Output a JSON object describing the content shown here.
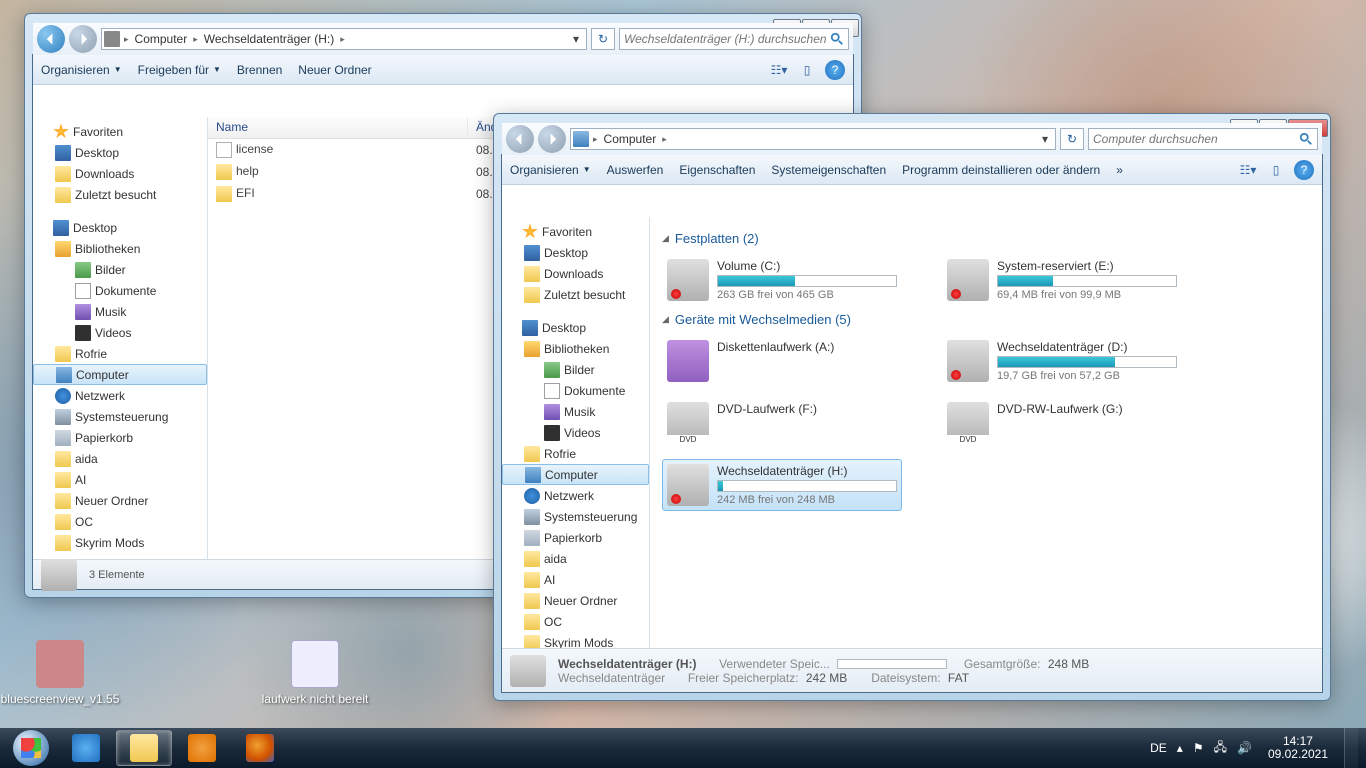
{
  "desktop_icons": [
    {
      "label": "bluescreenview_v1.55"
    },
    {
      "label": "laufwerk nicht bereit"
    }
  ],
  "win1": {
    "nav": {
      "crumb1": "Computer",
      "crumb2": "Wechseldatenträger (H:)"
    },
    "search_ph": "Wechseldatenträger (H:) durchsuchen",
    "toolbar": {
      "org": "Organisieren",
      "share": "Freigeben für",
      "burn": "Brennen",
      "newfolder": "Neuer Ordner"
    },
    "cols": {
      "name": "Name",
      "date": "Änd"
    },
    "files": [
      {
        "name": "license",
        "date": "08.0",
        "type": "file"
      },
      {
        "name": "help",
        "date": "08.0",
        "type": "folder"
      },
      {
        "name": "EFI",
        "date": "08.0",
        "type": "folder"
      }
    ],
    "status": "3 Elemente"
  },
  "win2": {
    "nav": {
      "crumb1": "Computer"
    },
    "search_ph": "Computer durchsuchen",
    "toolbar": {
      "org": "Organisieren",
      "eject": "Auswerfen",
      "props": "Eigenschaften",
      "sysprops": "Systemeigenschaften",
      "uninstall": "Programm deinstallieren oder ändern"
    },
    "groups": [
      {
        "title": "Festplatten (2)",
        "drives": [
          {
            "name": "Volume (C:)",
            "free": "263 GB frei von 465 GB",
            "pct": 43,
            "type": "hdd"
          },
          {
            "name": "System-reserviert (E:)",
            "free": "69,4 MB frei von 99,9 MB",
            "pct": 31,
            "type": "hdd"
          }
        ]
      },
      {
        "title": "Geräte mit Wechselmedien (5)",
        "drives": [
          {
            "name": "Diskettenlaufwerk (A:)",
            "free": "",
            "pct": -1,
            "type": "floppy"
          },
          {
            "name": "Wechseldatenträger (D:)",
            "free": "19,7 GB frei von 57,2 GB",
            "pct": 66,
            "type": "hdd"
          },
          {
            "name": "DVD-Laufwerk (F:)",
            "free": "",
            "pct": -1,
            "type": "dvd"
          },
          {
            "name": "DVD-RW-Laufwerk (G:)",
            "free": "",
            "pct": -1,
            "type": "dvd"
          },
          {
            "name": "Wechseldatenträger (H:)",
            "free": "242 MB frei von 248 MB",
            "pct": 3,
            "type": "hdd",
            "sel": true
          }
        ]
      }
    ],
    "status": {
      "title": "Wechseldatenträger (H:)",
      "subtitle": "Wechseldatenträger",
      "used_lbl": "Verwendeter Speic...",
      "free_lbl": "Freier Speicherplatz:",
      "free_val": "242 MB",
      "size_lbl": "Gesamtgröße:",
      "size_val": "248 MB",
      "fs_lbl": "Dateisystem:",
      "fs_val": "FAT"
    }
  },
  "sidebar": [
    {
      "label": "Favoriten",
      "ico": "star",
      "lvl": "hdr"
    },
    {
      "label": "Desktop",
      "ico": "desktop",
      "lvl": "lvl1"
    },
    {
      "label": "Downloads",
      "ico": "folder",
      "lvl": "lvl1"
    },
    {
      "label": "Zuletzt besucht",
      "ico": "folder",
      "lvl": "lvl1"
    },
    {
      "sep": true
    },
    {
      "label": "Desktop",
      "ico": "desktop",
      "lvl": "hdr"
    },
    {
      "label": "Bibliotheken",
      "ico": "lib",
      "lvl": "lvl1"
    },
    {
      "label": "Bilder",
      "ico": "pic",
      "lvl": "lvl2"
    },
    {
      "label": "Dokumente",
      "ico": "doc",
      "lvl": "lvl2"
    },
    {
      "label": "Musik",
      "ico": "music",
      "lvl": "lvl2"
    },
    {
      "label": "Videos",
      "ico": "video",
      "lvl": "lvl2"
    },
    {
      "label": "Rofrie",
      "ico": "folder",
      "lvl": "lvl1"
    },
    {
      "label": "Computer",
      "ico": "computer",
      "lvl": "lvl1",
      "sel": true
    },
    {
      "label": "Netzwerk",
      "ico": "network",
      "lvl": "lvl1"
    },
    {
      "label": "Systemsteuerung",
      "ico": "ctrl",
      "lvl": "lvl1"
    },
    {
      "label": "Papierkorb",
      "ico": "trash",
      "lvl": "lvl1"
    },
    {
      "label": "aida",
      "ico": "folder",
      "lvl": "lvl1"
    },
    {
      "label": "AI",
      "ico": "folder",
      "lvl": "lvl1"
    },
    {
      "label": "Neuer Ordner",
      "ico": "folder",
      "lvl": "lvl1"
    },
    {
      "label": "OC",
      "ico": "folder",
      "lvl": "lvl1"
    },
    {
      "label": "Skyrim Mods",
      "ico": "folder",
      "lvl": "lvl1"
    }
  ],
  "tray": {
    "lang": "DE",
    "time": "14:17",
    "date": "09.02.2021"
  }
}
